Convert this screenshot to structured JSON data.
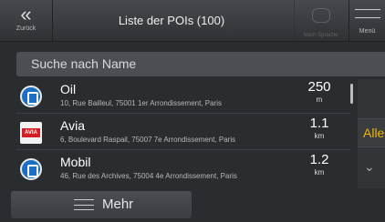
{
  "header": {
    "back_label": "Zurück",
    "back_glyph": "«",
    "title": "Liste der POIs (100)",
    "faded_label": "Nach Sprache",
    "menu_label": "Menü"
  },
  "search": {
    "placeholder": "Suche nach Name"
  },
  "pois": [
    {
      "name": "Oil",
      "address": "10, Rue Bailleul, 75001 1er Arrondissement, Paris",
      "distance": "250",
      "unit": "m",
      "icon": "fuel-station-icon"
    },
    {
      "name": "Avia",
      "address": "6, Boulevard Raspail, 75007 7e Arrondissement, Paris",
      "distance": "1.1",
      "unit": "km",
      "icon": "avia-logo-icon",
      "logo_text": "AVIA"
    },
    {
      "name": "Mobil",
      "address": "46, Rue des Archives, 75004 4e Arrondissement, Paris",
      "distance": "1.2",
      "unit": "km",
      "icon": "fuel-station-icon"
    }
  ],
  "side": {
    "all_label": "Alle",
    "collapse_glyph": "⌄"
  },
  "footer": {
    "more_label": "Mehr"
  },
  "colors": {
    "accent": "#f1b400",
    "background": "#2a2d30",
    "avia_red": "#d41f26",
    "fuel_blue": "#1b6fc2"
  }
}
